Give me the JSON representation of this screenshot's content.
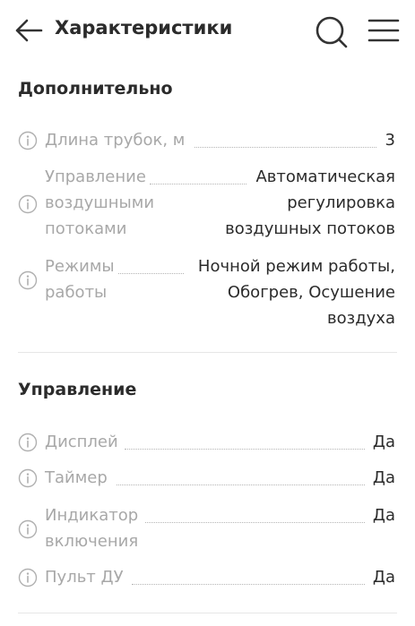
{
  "header": {
    "title": "Характеристики",
    "back_icon": "arrow-left-icon",
    "search_icon": "search-icon",
    "menu_icon": "hamburger-menu-icon"
  },
  "sections": [
    {
      "title": "Дополнительно",
      "rows": [
        {
          "label": [
            "Длина трубок, м"
          ],
          "value": [
            "3"
          ]
        },
        {
          "label": [
            "Управление",
            "воздушными",
            "потоками"
          ],
          "value": [
            "Автоматическая",
            "регулировка",
            "воздушных потоков"
          ]
        },
        {
          "label": [
            "Режимы",
            "работы"
          ],
          "value": [
            "Ночной режим работы,",
            "Обогрев, Осушение",
            "воздуха"
          ]
        }
      ]
    },
    {
      "title": "Управление",
      "rows": [
        {
          "label": [
            "Дисплей"
          ],
          "value": [
            "Да"
          ]
        },
        {
          "label": [
            "Таймер"
          ],
          "value": [
            "Да"
          ]
        },
        {
          "label": [
            "Индикатор",
            "включения"
          ],
          "value": [
            "Да"
          ]
        },
        {
          "label": [
            "Пульт ДУ"
          ],
          "value": [
            "Да"
          ]
        }
      ]
    }
  ],
  "colors": {
    "text": "#2b2b2b",
    "label": "#a8a8a8",
    "divider": "#e6e6e6",
    "icon": "#333333"
  }
}
